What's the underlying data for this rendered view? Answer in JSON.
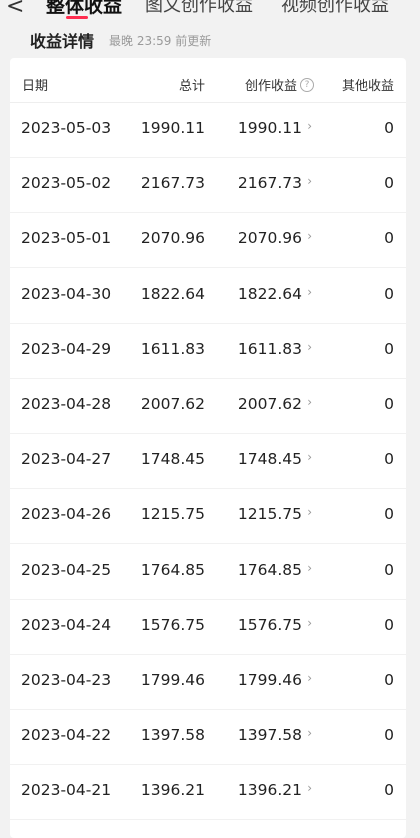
{
  "nav": {
    "back": "<",
    "tabs": [
      "整体收益",
      "图文创作收益",
      "视频创作收益"
    ],
    "active_index": 0,
    "accent": "#ff2d4f"
  },
  "section": {
    "title": "收益详情",
    "updated": "最晚 23:59 前更新"
  },
  "table": {
    "headers": {
      "date": "日期",
      "total": "总计",
      "creation": "创作收益",
      "other": "其他收益"
    },
    "rows": [
      {
        "date": "2023-05-03",
        "total": "1990.11",
        "creation": "1990.11",
        "other": "0"
      },
      {
        "date": "2023-05-02",
        "total": "2167.73",
        "creation": "2167.73",
        "other": "0"
      },
      {
        "date": "2023-05-01",
        "total": "2070.96",
        "creation": "2070.96",
        "other": "0"
      },
      {
        "date": "2023-04-30",
        "total": "1822.64",
        "creation": "1822.64",
        "other": "0"
      },
      {
        "date": "2023-04-29",
        "total": "1611.83",
        "creation": "1611.83",
        "other": "0"
      },
      {
        "date": "2023-04-28",
        "total": "2007.62",
        "creation": "2007.62",
        "other": "0"
      },
      {
        "date": "2023-04-27",
        "total": "1748.45",
        "creation": "1748.45",
        "other": "0"
      },
      {
        "date": "2023-04-26",
        "total": "1215.75",
        "creation": "1215.75",
        "other": "0"
      },
      {
        "date": "2023-04-25",
        "total": "1764.85",
        "creation": "1764.85",
        "other": "0"
      },
      {
        "date": "2023-04-24",
        "total": "1576.75",
        "creation": "1576.75",
        "other": "0"
      },
      {
        "date": "2023-04-23",
        "total": "1799.46",
        "creation": "1799.46",
        "other": "0"
      },
      {
        "date": "2023-04-22",
        "total": "1397.58",
        "creation": "1397.58",
        "other": "0"
      },
      {
        "date": "2023-04-21",
        "total": "1396.21",
        "creation": "1396.21",
        "other": "0"
      }
    ]
  }
}
